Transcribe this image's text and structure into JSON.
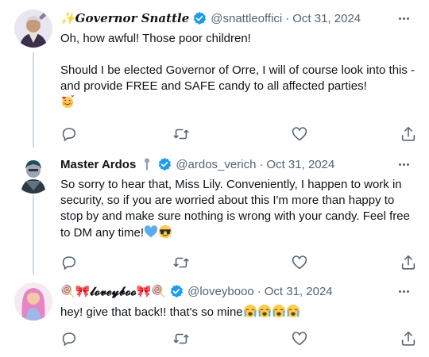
{
  "tweets": [
    {
      "display_name": "✨𝑮𝒐𝒗𝒆𝒓𝒏𝒐𝒓 𝑺𝒏𝒂𝒕𝒕𝒍𝒆",
      "handle": "@snattleoffici",
      "date": "Oct 31, 2024",
      "avatar_icon": "governor-avatar",
      "body_line1": "Oh, how awful! Those poor children!",
      "body_line2": "Should I be elected Governor of Orre, I will of course look into this - and provide FREE and SAFE candy to all affected parties!",
      "trailing_emoji": "smiling-face-with-hearts"
    },
    {
      "display_name": "Master Ardos",
      "name_emoji": "microphone",
      "handle": "@ardos_verich",
      "date": "Oct 31, 2024",
      "avatar_icon": "ardos-avatar",
      "body": "So sorry to hear that, Miss Lily. Conveniently, I happen to work in security, so if you are worried about this I'm more than happy to stop by and make sure nothing is wrong with your candy. Feel free to DM any time!",
      "trailing_emojis": [
        "blue-heart",
        "smiling-face-with-sunglasses"
      ]
    },
    {
      "display_name": "🍭🎀𝓵𝓸𝓿𝓮𝔂𝓫𝓸𝓸🎀🍭",
      "handle": "@loveybooo",
      "date": "Oct 31, 2024",
      "avatar_icon": "lovey-avatar",
      "body": "hey! give that back!! that's so mine",
      "trailing_emojis": [
        "loudly-crying-face",
        "loudly-crying-face",
        "loudly-crying-face",
        "loudly-crying-face"
      ]
    }
  ],
  "colors": {
    "verified_blue": "#1d9bf0",
    "muted_text": "#536471",
    "thread_line": "#cfd9de",
    "text": "#0f1419"
  },
  "actions": [
    "reply-icon",
    "retweet-icon",
    "like-icon",
    "share-icon"
  ]
}
